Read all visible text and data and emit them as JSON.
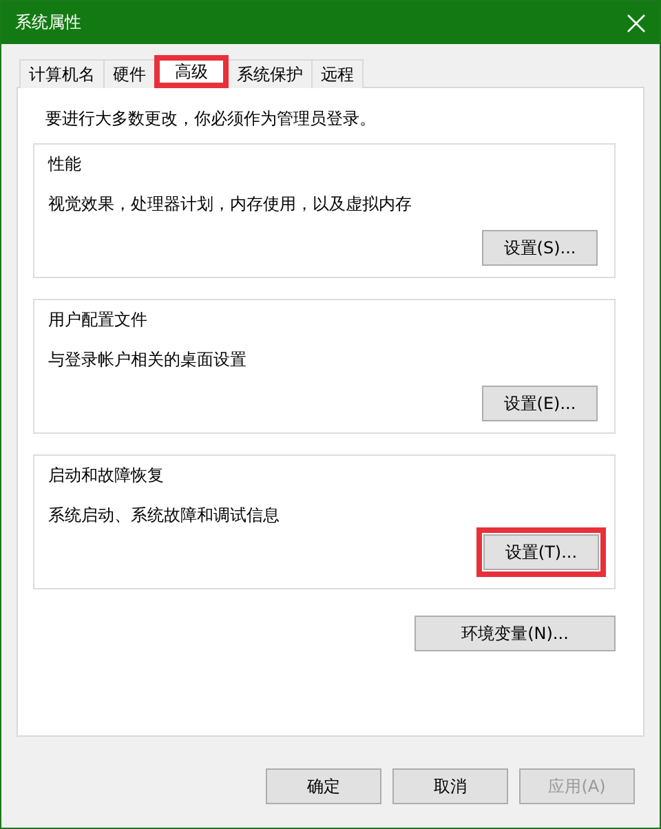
{
  "window": {
    "title": "系统属性"
  },
  "tabs": [
    {
      "label": "计算机名",
      "selected": false,
      "highlighted": false
    },
    {
      "label": "硬件",
      "selected": false,
      "highlighted": false
    },
    {
      "label": "高级",
      "selected": true,
      "highlighted": true
    },
    {
      "label": "系统保护",
      "selected": false,
      "highlighted": false
    },
    {
      "label": "远程",
      "selected": false,
      "highlighted": false
    }
  ],
  "notice": "要进行大多数更改，你必须作为管理员登录。",
  "groups": [
    {
      "title": "性能",
      "description": "视觉效果，处理器计划，内存使用，以及虚拟内存",
      "button": {
        "label": "设置(S)...",
        "highlighted": false
      }
    },
    {
      "title": "用户配置文件",
      "description": "与登录帐户相关的桌面设置",
      "button": {
        "label": "设置(E)...",
        "highlighted": false
      }
    },
    {
      "title": "启动和故障恢复",
      "description": "系统启动、系统故障和调试信息",
      "button": {
        "label": "设置(T)...",
        "highlighted": true
      }
    }
  ],
  "env_button": {
    "label": "环境变量(N)..."
  },
  "buttons": [
    {
      "label": "确定",
      "disabled": false
    },
    {
      "label": "取消",
      "disabled": false
    },
    {
      "label": "应用(A)",
      "disabled": true
    }
  ]
}
